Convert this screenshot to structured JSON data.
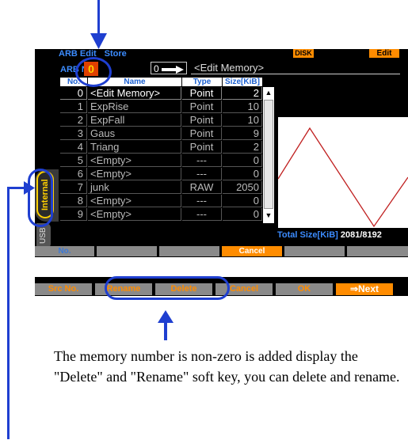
{
  "header": {
    "title_part1": "ARB Edit",
    "title_part2": "Store",
    "disk_badge": "DISK",
    "edit_badge": "Edit",
    "arb_no_label": "ARB N",
    "arb_no_value": "0",
    "arrow_label": "0",
    "target_name": "<Edit Memory>"
  },
  "table": {
    "columns": [
      "No.",
      "Name",
      "Type",
      "Size[KiB]"
    ],
    "rows": [
      {
        "no": "0",
        "name": "<Edit Memory>",
        "type": "Point",
        "size": "2"
      },
      {
        "no": "1",
        "name": "ExpRise",
        "type": "Point",
        "size": "10"
      },
      {
        "no": "2",
        "name": "ExpFall",
        "type": "Point",
        "size": "10"
      },
      {
        "no": "3",
        "name": "Gaus",
        "type": "Point",
        "size": "9"
      },
      {
        "no": "4",
        "name": "Triang",
        "type": "Point",
        "size": "2"
      },
      {
        "no": "5",
        "name": "<Empty>",
        "type": "---",
        "size": "0"
      },
      {
        "no": "6",
        "name": "<Empty>",
        "type": "---",
        "size": "0"
      },
      {
        "no": "7",
        "name": "junk",
        "type": "RAW",
        "size": "2050"
      },
      {
        "no": "8",
        "name": "<Empty>",
        "type": "---",
        "size": "0"
      },
      {
        "no": "9",
        "name": "<Empty>",
        "type": "---",
        "size": "0"
      }
    ]
  },
  "total": {
    "label": "Total Size[KiB]",
    "value": "2081/8192"
  },
  "side_tabs": {
    "internal": "Internal",
    "usb": "USB"
  },
  "softkeys1": [
    "No.",
    "",
    "",
    "Cancel",
    "",
    ""
  ],
  "softkeys2": [
    "Src No.",
    "Rename",
    "Delete",
    "Cancel",
    "OK",
    "⇒Next"
  ],
  "note": "The memory number is non-zero is added display the \"Delete\" and \"Rename\" soft key, you can delete and rename.",
  "colors": {
    "accent": "#1f3fd0",
    "orange": "#ff8c00",
    "blue_text": "#3c8cff",
    "wave": "#c02020"
  }
}
